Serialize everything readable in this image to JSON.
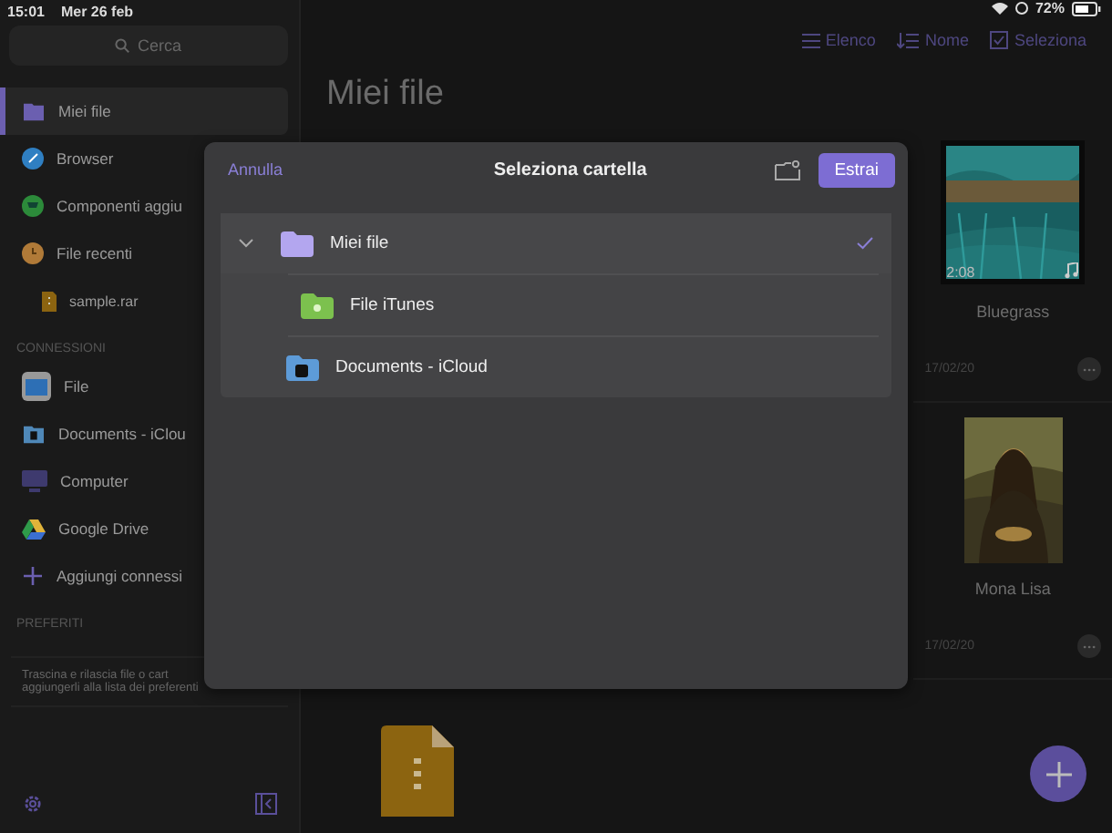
{
  "status_bar": {
    "time": "15:01",
    "date": "Mer 26 feb",
    "battery": "72%"
  },
  "sidebar": {
    "search": {
      "placeholder": "Cerca"
    },
    "items": [
      {
        "label": "Miei file",
        "selected": true
      },
      {
        "label": "Browser",
        "selected": false
      },
      {
        "label": "Componenti aggiu",
        "selected": false
      },
      {
        "label": "File recenti",
        "selected": false,
        "children": [
          {
            "label": "sample.rar",
            "selected": false
          }
        ]
      }
    ],
    "sections": [
      {
        "title": "CONNESSIONI",
        "items": [
          {
            "label": "File"
          },
          {
            "label": "Documents - iClou"
          },
          {
            "label": "Computer"
          },
          {
            "label": "Google Drive"
          },
          {
            "label": "Aggiungi connessi"
          }
        ]
      },
      {
        "title": "PREFERITI",
        "hint_lines": [
          "Trascina e rilascia file o cart",
          "aggiungerli alla lista dei preferenti"
        ]
      }
    ]
  },
  "toolbar": [
    "Elenco",
    "Nome",
    "Seleziona"
  ],
  "title": "Miei file",
  "files": [
    {
      "kind": "audio",
      "name": "Bluegrass",
      "duration": "2:08",
      "date": "17/02/20"
    },
    {
      "name": "Mona Lisa",
      "date": "17/02/20"
    },
    {
      "kind": "archive"
    }
  ],
  "dialog": {
    "cancel": "Annulla",
    "title": "Seleziona cartella",
    "confirm": "Estrai",
    "folders": [
      {
        "label": "Miei file",
        "expanded": true,
        "selected": true,
        "children": [
          {
            "label": "File iTunes",
            "selected": false
          }
        ]
      },
      {
        "label": "Documents - iCloud",
        "selected": false
      }
    ]
  }
}
